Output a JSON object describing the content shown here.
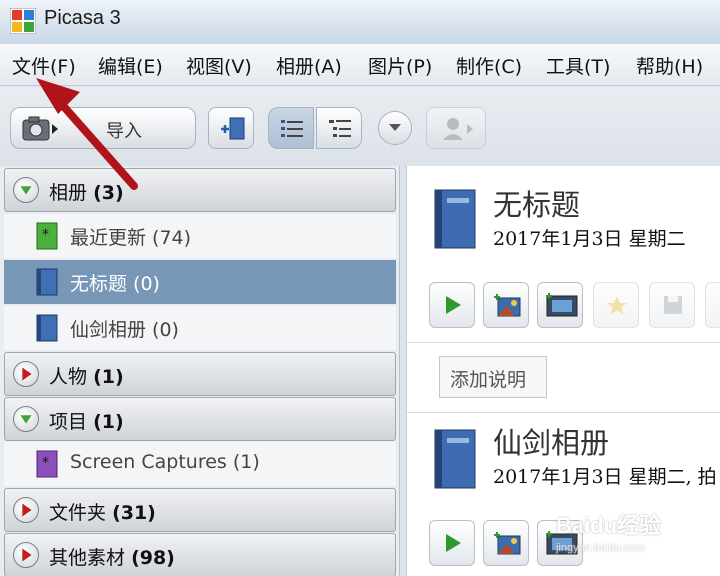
{
  "window": {
    "title": "Picasa 3"
  },
  "menu": {
    "items": [
      "文件(F)",
      "编辑(E)",
      "视图(V)",
      "相册(A)",
      "图片(P)",
      "制作(C)",
      "工具(T)",
      "帮助(H)"
    ]
  },
  "toolbar": {
    "import_label": "导入"
  },
  "sidebar": {
    "albums_header": {
      "name": "相册",
      "count": "(3)"
    },
    "albums": [
      {
        "label": "最近更新 (74)",
        "icon": "recent-album-icon"
      },
      {
        "label": "无标题 (0)",
        "icon": "album-book-icon",
        "selected": true
      },
      {
        "label": "仙剑相册 (0)",
        "icon": "album-book-icon"
      }
    ],
    "people_header": {
      "name": "人物",
      "count": "(1)"
    },
    "projects_header": {
      "name": "项目",
      "count": "(1)"
    },
    "projects": [
      {
        "label": "Screen Captures (1)",
        "icon": "screen-captures-icon"
      }
    ],
    "folders_header": {
      "name": "文件夹",
      "count": "(31)"
    },
    "other_header": {
      "name": "其他素材",
      "count": "(98)"
    }
  },
  "main": {
    "album1": {
      "title": "无标题",
      "date": "2017年1月3日 星期二"
    },
    "caption_label": "添加说明",
    "album2": {
      "title": "仙剑相册",
      "date": "2017年1月3日 星期二, 拍"
    }
  },
  "watermark": {
    "line1": "Baidu经验",
    "line2": "jingyan.baidu.com"
  },
  "colors": {
    "selected_row": "#7897b6",
    "annotation_arrow": "#b0141a",
    "expand_green": "#3aa53a",
    "collapse_red": "#c0201c"
  }
}
